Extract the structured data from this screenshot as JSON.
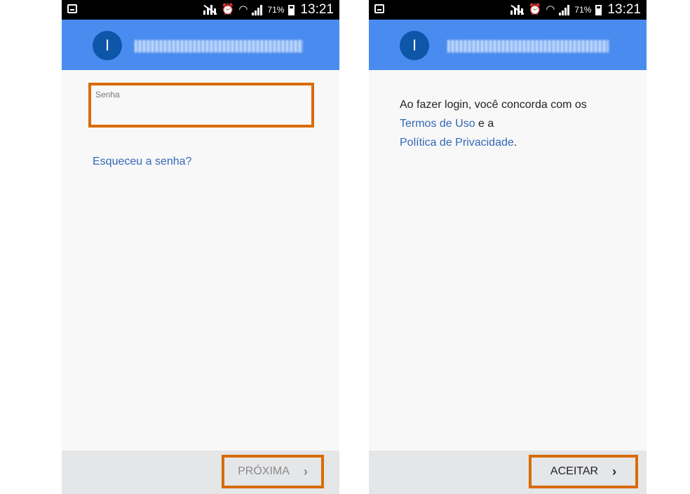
{
  "status_bar": {
    "battery": "71%",
    "time": "13:21"
  },
  "screens": {
    "left": {
      "avatar_initial": "I",
      "email": "████████████",
      "password_label": "Senha",
      "password_value": "",
      "forgot_link": "Esqueceu a senha?",
      "next_button": "PRÓXIMA",
      "next_chevron": "›"
    },
    "right": {
      "avatar_initial": "I",
      "email": "████████████",
      "terms_text_1": "Ao fazer login, você concorda com os",
      "terms_link": "Termos de Uso",
      "terms_and": " e a",
      "privacy_link": "Política de Privacidade",
      "terms_period": ".",
      "accept_button": "ACEITAR",
      "accept_chevron": "›"
    }
  },
  "colors": {
    "header_blue": "#4a8bf0",
    "avatar_blue": "#0d56a8",
    "highlight_orange": "#d96c07",
    "link_blue": "#3367b8"
  }
}
